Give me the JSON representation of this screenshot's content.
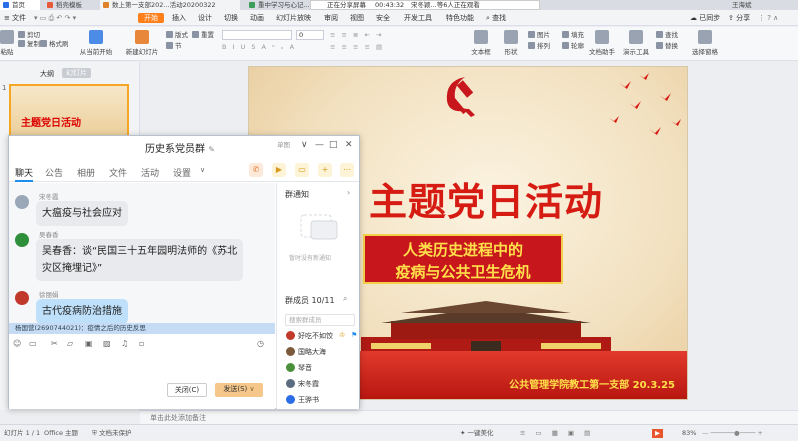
{
  "window_tabs": [
    {
      "label": "首页",
      "color": "#2b6de6"
    },
    {
      "label": "稻壳模板",
      "color": "#e85a3c"
    },
    {
      "label": "数上第一支部202...活动20200322",
      "color": "#e0822a"
    },
    {
      "label": "重中学习与心记...",
      "color": "#3c9e5a"
    }
  ],
  "share_bar": {
    "status": "正在分享屏幕",
    "time": "00:43:32",
    "viewers": "宋冬颖...等6人正在观看"
  },
  "user_name": "王海斌",
  "menu": {
    "file": "文件",
    "items": [
      "开始",
      "插入",
      "设计",
      "切换",
      "动画",
      "幻灯片放映",
      "审阅",
      "视图",
      "安全",
      "开发工具",
      "特色功能"
    ],
    "active": "开始",
    "search": "查找",
    "sync": "已同步",
    "share": "分享"
  },
  "ribbon": {
    "paste": "粘贴",
    "cut": "剪切",
    "copy": "复制",
    "format_painter": "格式刷",
    "play_from_current": "从当前开始",
    "new_slide": "新建幻灯片",
    "layout": "版式",
    "section": "节",
    "reset": "重置",
    "text_box": "文本框",
    "shape": "形状",
    "arrange": "排列",
    "outline": "轮廓",
    "picture": "图片",
    "fill": "填充",
    "document_helper": "文档助手",
    "presentation_tool": "演示工具",
    "find": "查找",
    "replace": "替换",
    "select_pane": "选择窗格",
    "font_size": "0"
  },
  "left_panel": {
    "outline_tab": "大纲",
    "slides_tab": "幻灯片",
    "slide_number": "1",
    "thumb_title": "主题党日活动"
  },
  "slide": {
    "title": "主题党日活动",
    "subtitle_line1": "人类历史进程中的",
    "subtitle_line2": "疫病与公共卫生危机",
    "footer": "公共管理学院教工第一支部  20.3.25"
  },
  "chat": {
    "title": "历史系党员群",
    "window_buttons": {
      "pin": "单图",
      "min": "—",
      "max": "□",
      "close": "✕"
    },
    "tabs": [
      "聊天",
      "公告",
      "相册",
      "文件",
      "活动",
      "设置"
    ],
    "active_tab": "聊天",
    "messages": [
      {
        "sender": "宋冬霞",
        "text": "大瘟疫与社会应对",
        "color": "#9aa7b8"
      },
      {
        "sender": "吴春香",
        "text_line1": "吴春香：谈“民国三十五年园明法师的《苏北",
        "text_line2": "灾区掩埋记》”",
        "color": "#2f8f3a"
      },
      {
        "sender": "徐丽娟",
        "text": "古代疫病防治措施",
        "color": "#c0392b"
      }
    ],
    "mention": "杨国营(2690744021)：疫情之后的历史反思",
    "close_button": "关闭(C)",
    "send_button": "发送(S)",
    "notice_title": "群通知",
    "notice_empty": "暂时没有新通知",
    "members_title": "群成员 10/11",
    "search_members": "搜索群成员",
    "members": [
      {
        "name": "好吃不如饺",
        "color": "#c0392b"
      },
      {
        "name": "国略大海",
        "color": "#7d5a3c"
      },
      {
        "name": "琴音",
        "color": "#4a8f3a"
      },
      {
        "name": "宋冬霞",
        "color": "#5b6b80"
      },
      {
        "name": "王骅书",
        "color": "#2b6de6"
      }
    ]
  },
  "notes_placeholder": "单击此处添加备注",
  "status": {
    "slide_count": "幻灯片 1 / 1",
    "theme": "Office 主题",
    "doc_protect": "文档未保护",
    "beautify": "一键美化",
    "zoom": "83%"
  },
  "colors": {
    "accent": "#ff7f1a",
    "slide_red": "#d61b12",
    "gold": "#ffe04a",
    "send_btn": "#f5c78a"
  }
}
